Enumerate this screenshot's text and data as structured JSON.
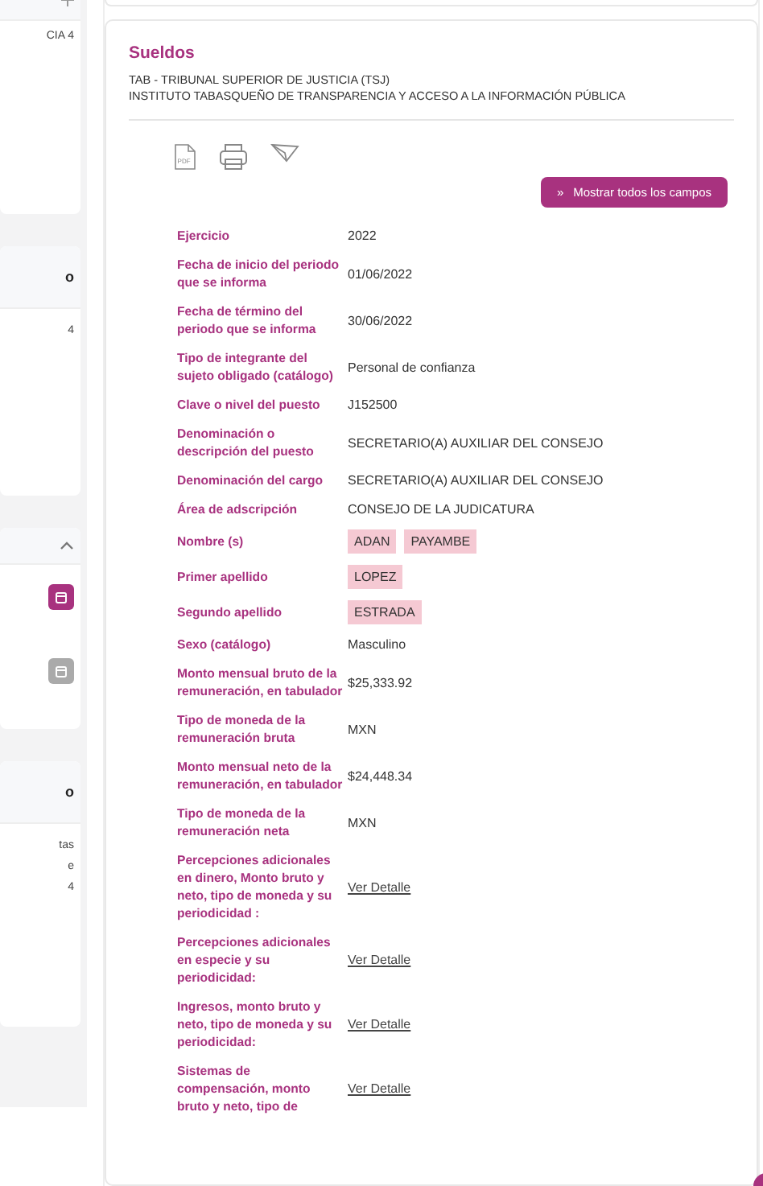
{
  "sidebar": {
    "cards": [
      {
        "kind": "add",
        "lines": [
          "CIA 4"
        ]
      },
      {
        "kind": "count",
        "header": "o",
        "lines": [
          "4"
        ]
      },
      {
        "kind": "dates",
        "buttons": [
          {
            "disabled": false
          },
          {
            "disabled": true
          }
        ]
      },
      {
        "kind": "count",
        "header": "o",
        "lines": [
          "tas",
          "e",
          "4"
        ]
      }
    ]
  },
  "record": {
    "title": "Sueldos",
    "subtitle_lines": [
      "TAB - TRIBUNAL SUPERIOR DE JUSTICIA (TSJ)",
      "INSTITUTO TABASQUEÑO DE TRANSPARENCIA Y ACCESO A LA INFORMACIÓN PÚBLICA"
    ],
    "actions": [
      {
        "kind": "pdf",
        "label": "PDF"
      },
      {
        "kind": "printer"
      },
      {
        "kind": "plane"
      }
    ],
    "expand_button": {
      "icon": "»",
      "label": "Mostrar todos los campos"
    },
    "fields": [
      {
        "label": "Ejercicio",
        "kind": "text",
        "value": "2022"
      },
      {
        "label": "Fecha de inicio del periodo que se informa",
        "kind": "text",
        "value": "01/06/2022"
      },
      {
        "label": "Fecha de término del periodo que se informa",
        "kind": "text",
        "value": "30/06/2022"
      },
      {
        "label": "Tipo de integrante del sujeto obligado (catálogo)",
        "kind": "text",
        "value": "Personal de confianza"
      },
      {
        "label": "Clave o nivel del puesto",
        "kind": "text",
        "value": "J152500"
      },
      {
        "label": "Denominación o descripción del puesto",
        "kind": "text",
        "value": "SECRETARIO(A) AUXILIAR DEL CONSEJO"
      },
      {
        "label": "Denominación del cargo",
        "kind": "text",
        "value": "SECRETARIO(A) AUXILIAR DEL CONSEJO"
      },
      {
        "label": "Área de adscripción",
        "kind": "text",
        "value": "CONSEJO DE LA JUDICATURA"
      },
      {
        "label": "Nombre (s)",
        "kind": "tags",
        "tags": [
          "ADAN",
          "PAYAMBE"
        ]
      },
      {
        "label": "Primer apellido",
        "kind": "tags",
        "tags": [
          "LOPEZ"
        ]
      },
      {
        "label": "Segundo apellido",
        "kind": "tags",
        "tags": [
          "ESTRADA"
        ]
      },
      {
        "label": "Sexo (catálogo)",
        "kind": "text",
        "value": "Masculino"
      },
      {
        "label": "Monto mensual bruto de la remuneración, en tabulador",
        "kind": "text",
        "value": "$25,333.92"
      },
      {
        "label": "Tipo de moneda de la remuneración bruta",
        "kind": "text",
        "value": "MXN"
      },
      {
        "label": "Monto mensual neto de la remuneración, en tabulador",
        "kind": "text",
        "value": "$24,448.34"
      },
      {
        "label": "Tipo de moneda de la remuneración neta",
        "kind": "text",
        "value": "MXN"
      },
      {
        "label": "Percepciones adicionales en dinero, Monto bruto y neto, tipo de moneda y su periodicidad :",
        "kind": "link",
        "value": "Ver Detalle"
      },
      {
        "label": "Percepciones adicionales en especie y su periodicidad:",
        "kind": "link",
        "value": "Ver Detalle"
      },
      {
        "label": "Ingresos, monto bruto y neto, tipo de moneda y su periodicidad:",
        "kind": "link",
        "value": "Ver Detalle"
      },
      {
        "label": "Sistemas de compensación, monto bruto y neto, tipo de",
        "kind": "link",
        "value": "Ver Detalle"
      }
    ]
  }
}
